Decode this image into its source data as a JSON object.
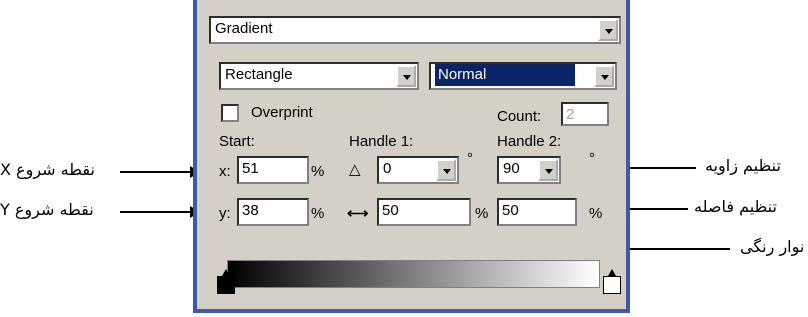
{
  "panel": {
    "fill_type": "Gradient",
    "shape": "Rectangle",
    "blend_mode": "Normal",
    "overprint_label": "Overprint",
    "count_label": "Count:",
    "count_value": "2",
    "start_label": "Start:",
    "handle1_label": "Handle 1:",
    "handle2_label": "Handle 2:",
    "x_label": "x:",
    "x_value": "51",
    "x_unit": "%",
    "y_label": "y:",
    "y_value": "38",
    "y_unit": "%",
    "h1_angle": "0",
    "h1_angle_unit": "°",
    "h2_angle": "90",
    "h2_angle_unit": "°",
    "h1_length": "50",
    "h1_length_unit": "%",
    "h2_length": "50",
    "h2_length_unit": "%"
  },
  "callouts": {
    "x_start": "X نقطه شروع",
    "y_start": "Y نقطه شروع",
    "angle": "تنظیم زاویه",
    "distance": "تنظیم فاصله",
    "color_bar": "نوار رنگی"
  },
  "colors": {
    "border": "#3c5aa8",
    "panel_bg": "#d4d0c8",
    "highlight": "#0a246a"
  }
}
